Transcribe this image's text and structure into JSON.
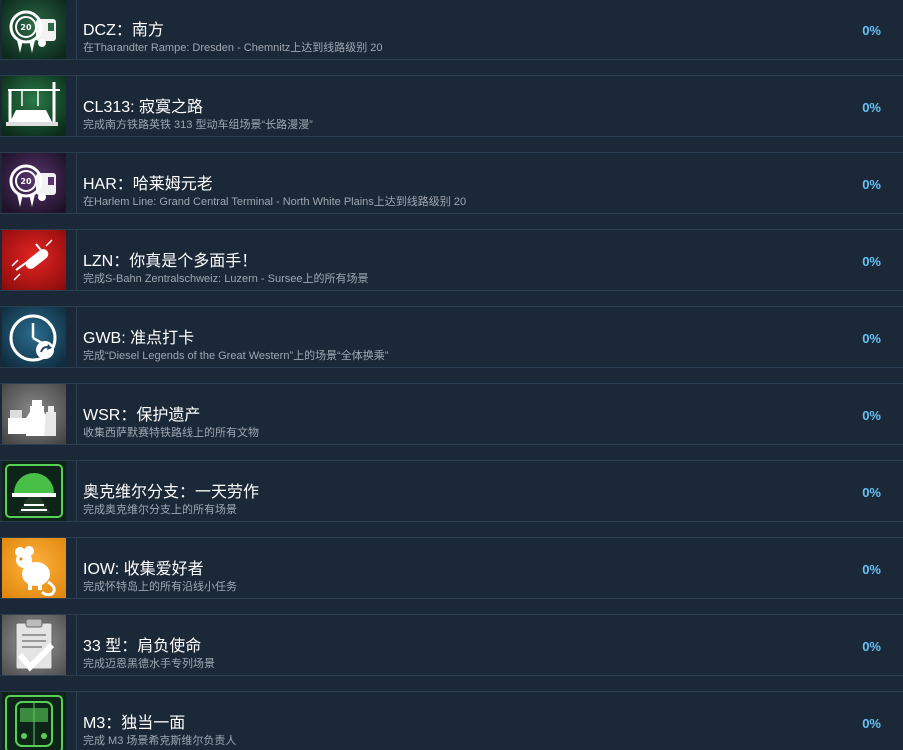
{
  "achievements": [
    {
      "title": "DCZ：南方",
      "desc": "在Tharandter Rampe: Dresden - Chemnitz上达到线路级别 20",
      "percent": "0%",
      "icon": "award-ribbon-truck-icon",
      "icon_bg": "#1f4a32"
    },
    {
      "title": "CL313: 寂寞之路",
      "desc": "完成南方铁路英铁 313 型动车组场景“长路漫漫”",
      "percent": "0%",
      "icon": "overhead-gantry-icon",
      "icon_bg": "#174a2c"
    },
    {
      "title": "HAR：哈莱姆元老",
      "desc": "在Harlem Line: Grand Central Terminal - North White Plains上达到线路级别 20",
      "percent": "0%",
      "icon": "award-ribbon-truck-icon",
      "icon_bg": "#3a2346"
    },
    {
      "title": "LZN：你真是个多面手！",
      "desc": "完成S-Bahn Zentralschweiz: Luzern - Sursee上的所有场景",
      "percent": "0%",
      "icon": "swiss-army-knife-icon",
      "icon_bg": "#c81a1a"
    },
    {
      "title": "GWB: 准点打卡",
      "desc": "完成“Diesel Legends of the Great Western”上的场景“全体换乘”",
      "percent": "0%",
      "icon": "clock-arrow-icon",
      "icon_bg": "#1e4c66"
    },
    {
      "title": "WSR：保护遗产",
      "desc": "收集西萨默赛特铁路线上的所有文物",
      "percent": "0%",
      "icon": "milk-churns-icon",
      "icon_bg": "#6e6e6e"
    },
    {
      "title": "奥克维尔分支：一天劳作",
      "desc": "完成奥克维尔分支上的所有场景",
      "percent": "0%",
      "icon": "sunrise-rails-icon",
      "icon_bg": "#1f4a2c"
    },
    {
      "title": "IOW: 收集爱好者",
      "desc": "完成怀特岛上的所有沿线小任务",
      "percent": "0%",
      "icon": "mouse-icon",
      "icon_bg": "#f39c1f"
    },
    {
      "title": "33 型：肩负使命",
      "desc": "完成迈恩黑德水手专列场景",
      "percent": "0%",
      "icon": "clipboard-check-icon",
      "icon_bg": "#7a7a7a"
    },
    {
      "title": "M3：独当一面",
      "desc": "完成 M3 场景希克斯维尔负责人",
      "percent": "0%",
      "icon": "train-front-icon",
      "icon_bg": "#1e4a2c"
    }
  ]
}
